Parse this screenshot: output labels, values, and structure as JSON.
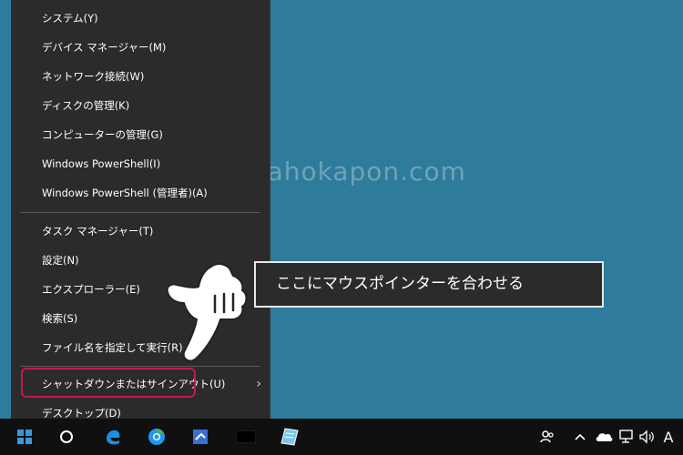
{
  "watermark": "hokahokapon.com",
  "menu": {
    "items": [
      {
        "label": "システム(Y)"
      },
      {
        "label": "デバイス マネージャー(M)"
      },
      {
        "label": "ネットワーク接続(W)"
      },
      {
        "label": "ディスクの管理(K)"
      },
      {
        "label": "コンピューターの管理(G)"
      },
      {
        "label": "Windows PowerShell(I)"
      },
      {
        "label": "Windows PowerShell (管理者)(A)"
      },
      {
        "label": "タスク マネージャー(T)"
      },
      {
        "label": "設定(N)"
      },
      {
        "label": "エクスプローラー(E)"
      },
      {
        "label": "検索(S)"
      },
      {
        "label": "ファイル名を指定して実行(R)"
      },
      {
        "label": "シャットダウンまたはサインアウト(U)"
      },
      {
        "label": "デスクトップ(D)"
      }
    ]
  },
  "callout": "ここにマウスポインターを合わせる",
  "taskbar": {
    "icons": [
      "windows-start-icon",
      "cortana-circle-icon",
      "edge-icon",
      "chrome-icon",
      "app-icon",
      "black-app-icon",
      "notepad-icon"
    ],
    "tray": {
      "icons": [
        "people-icon",
        "chevron-up-icon",
        "onedrive-icon",
        "network-icon",
        "volume-icon"
      ],
      "ime": "A"
    }
  },
  "colors": {
    "desktop": "#2e7b9b",
    "menu": "#2b2b2b",
    "highlight": "#c2185b",
    "taskbar": "#101010"
  }
}
